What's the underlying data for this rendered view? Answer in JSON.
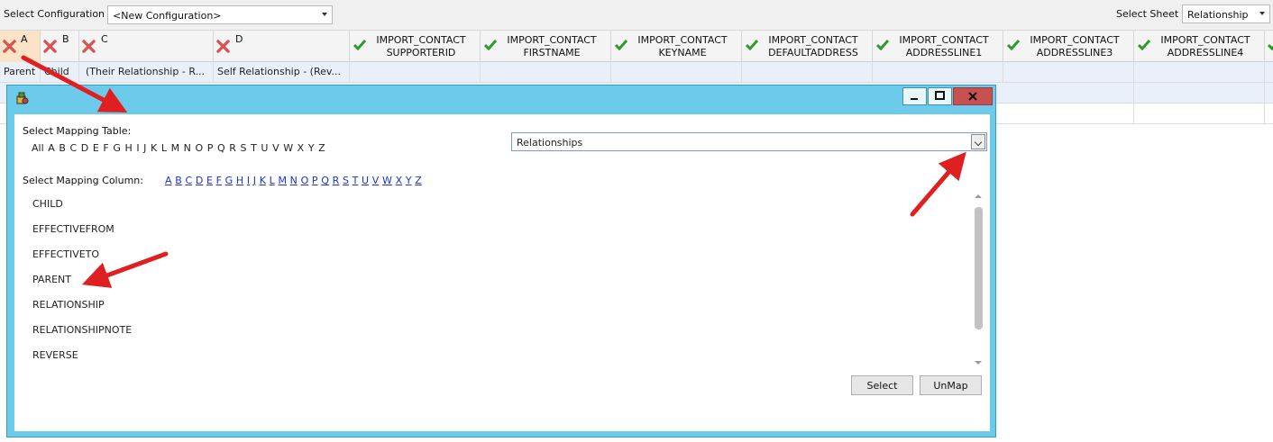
{
  "toolbar": {
    "config_label": "Select Configuration",
    "config_value": "<New Configuration>",
    "sheet_label": "Select Sheet",
    "sheet_value": "Relationship"
  },
  "grid": {
    "headers": [
      {
        "letter": "A",
        "status": "error"
      },
      {
        "letter": "B",
        "status": "error"
      },
      {
        "letter": "C",
        "status": "error"
      },
      {
        "letter": "D",
        "status": "error"
      },
      {
        "field": "IMPORT_CONTACT SUPPORTERID",
        "line1": "IMPORT_CONTACT",
        "line2": "SUPPORTERID",
        "status": "ok"
      },
      {
        "field": "IMPORT_CONTACT FIRSTNAME",
        "line1": "IMPORT_CONTACT",
        "line2": "FIRSTNAME",
        "status": "ok"
      },
      {
        "field": "IMPORT_CONTACT KEYNAME",
        "line1": "IMPORT_CONTACT",
        "line2": "KEYNAME",
        "status": "ok"
      },
      {
        "field": "IMPORT_CONTACT DEFAULTADDRESS",
        "line1": "IMPORT_CONTACT",
        "line2": "DEFAULTADDRESS",
        "status": "ok"
      },
      {
        "field": "IMPORT_CONTACT ADDRESSLINE1",
        "line1": "IMPORT_CONTACT",
        "line2": "ADDRESSLINE1",
        "status": "ok"
      },
      {
        "field": "IMPORT_CONTACT ADDRESSLINE3",
        "line1": "IMPORT_CONTACT",
        "line2": "ADDRESSLINE3",
        "status": "ok"
      },
      {
        "field": "IMPORT_CONTACT ADDRESSLINE4",
        "line1": "IMPORT_CONTACT",
        "line2": "ADDRESSLINE4",
        "status": "ok"
      }
    ],
    "row1": [
      "Parent",
      "Child",
      "(Their Relationship - R...",
      "Self Relationship - (Rev..."
    ]
  },
  "dialog": {
    "title_icon": "app-icon",
    "table_label": "Select Mapping Table:",
    "table_alpha": [
      "All",
      "A",
      "B",
      "C",
      "D",
      "E",
      "F",
      "G",
      "H",
      "I",
      "J",
      "K",
      "L",
      "M",
      "N",
      "O",
      "P",
      "Q",
      "R",
      "S",
      "T",
      "U",
      "V",
      "W",
      "X",
      "Y",
      "Z"
    ],
    "table_value": "Relationships",
    "column_label": "Select Mapping Column:",
    "column_alpha": [
      "A",
      "B",
      "C",
      "D",
      "E",
      "F",
      "G",
      "H",
      "I",
      "J",
      "K",
      "L",
      "M",
      "N",
      "O",
      "P",
      "Q",
      "R",
      "S",
      "T",
      "U",
      "V",
      "W",
      "X",
      "Y",
      "Z"
    ],
    "columns": [
      "CHILD",
      "EFFECTIVEFROM",
      "EFFECTIVETO",
      "PARENT",
      "RELATIONSHIP",
      "RELATIONSHIPNOTE",
      "REVERSE"
    ],
    "select_label": "Select",
    "unmap_label": "UnMap"
  },
  "colors": {
    "dialog_frame": "#6ccbea",
    "selected_header": "#fbe3c7",
    "error_icon": "#d9534f",
    "ok_icon": "#2e9a2e",
    "annotation_arrow": "#e02020",
    "link": "#1a35c8"
  }
}
